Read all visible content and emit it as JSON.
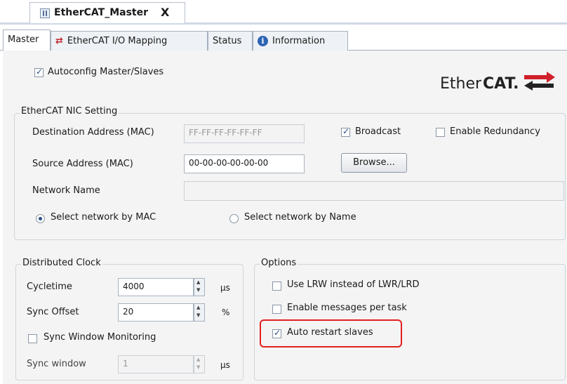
{
  "document_tab": {
    "title": "EtherCAT_Master",
    "close": "X"
  },
  "tabs": [
    {
      "label": "Master",
      "active": true
    },
    {
      "label": "EtherCAT I/O Mapping",
      "icon": "io-mapping-icon"
    },
    {
      "label": "Status"
    },
    {
      "label": "Information",
      "icon": "info-icon"
    }
  ],
  "autoconfig": {
    "label": "Autoconfig Master/Slaves",
    "checked": true
  },
  "logo": {
    "text_regular": "Ether",
    "text_bold": "CAT."
  },
  "nic": {
    "group_label": "EtherCAT NIC Setting",
    "dest_label": "Destination Address (MAC)",
    "dest_value": "FF-FF-FF-FF-FF-FF",
    "broadcast_label": "Broadcast",
    "broadcast_checked": true,
    "redundancy_label": "Enable Redundancy",
    "redundancy_checked": false,
    "source_label": "Source Address (MAC)",
    "source_value": "00-00-00-00-00-00",
    "browse_label": "Browse...",
    "network_label": "Network Name",
    "network_value": "",
    "radio_mac_label": "Select network by MAC",
    "radio_name_label": "Select network by Name"
  },
  "clock": {
    "group_label": "Distributed Clock",
    "cycletime_label": "Cycletime",
    "cycletime_value": "4000",
    "cycletime_unit": "µs",
    "sync_offset_label": "Sync Offset",
    "sync_offset_value": "20",
    "sync_offset_unit": "%",
    "sync_window_monitoring_label": "Sync Window Monitoring",
    "sync_window_label": "Sync window",
    "sync_window_value": "1",
    "sync_window_unit": "µs"
  },
  "options": {
    "group_label": "Options",
    "lrw_label": "Use LRW instead of LWR/LRD",
    "messages_label": "Enable messages per task",
    "auto_restart_label": "Auto restart slaves",
    "auto_restart_checked": true
  },
  "colors": {
    "highlight": "#e32020",
    "logo_red": "#d0202a",
    "checkbox_accent": "#2b4e86"
  }
}
